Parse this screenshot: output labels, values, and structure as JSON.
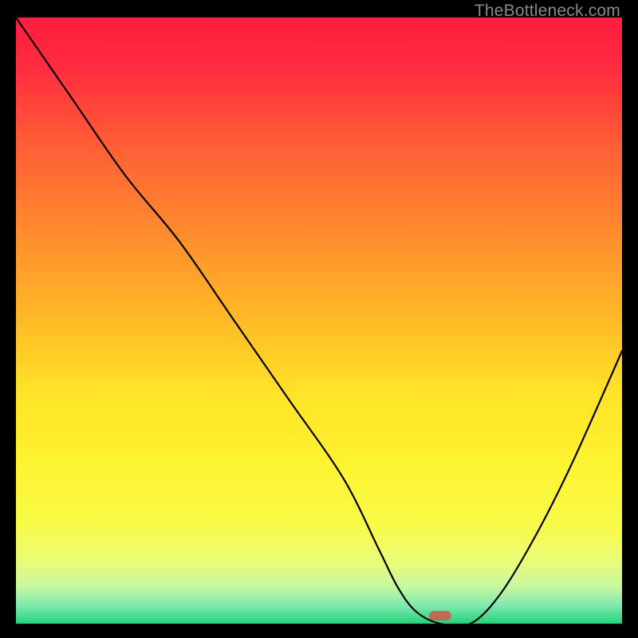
{
  "watermark": "TheBottleneck.com",
  "chart_data": {
    "type": "line",
    "title": "",
    "xlabel": "",
    "ylabel": "",
    "xlim": [
      0,
      100
    ],
    "ylim": [
      0,
      100
    ],
    "grid": false,
    "series": [
      {
        "name": "bottleneck-curve",
        "x": [
          0,
          9,
          18,
          27,
          36,
          45,
          54,
          60,
          63,
          66,
          70,
          75,
          80,
          86,
          92,
          100
        ],
        "y": [
          100,
          87,
          74,
          63,
          50,
          37,
          24,
          12,
          6,
          2,
          0,
          0,
          5,
          15,
          27,
          45
        ]
      }
    ],
    "gradient_stops": [
      {
        "pos": 0.0,
        "color": "#ff1d3f"
      },
      {
        "pos": 0.08,
        "color": "#ff2b3f"
      },
      {
        "pos": 0.2,
        "color": "#ff5a36"
      },
      {
        "pos": 0.35,
        "color": "#ff8a2e"
      },
      {
        "pos": 0.5,
        "color": "#ffbb27"
      },
      {
        "pos": 0.62,
        "color": "#ffe327"
      },
      {
        "pos": 0.74,
        "color": "#fdf431"
      },
      {
        "pos": 0.84,
        "color": "#f7fb4a"
      },
      {
        "pos": 0.9,
        "color": "#e8fc7a"
      },
      {
        "pos": 0.94,
        "color": "#c4f8a0"
      },
      {
        "pos": 0.97,
        "color": "#7fe9af"
      },
      {
        "pos": 1.0,
        "color": "#22d47a"
      }
    ],
    "marker": {
      "x_fraction": 0.7,
      "y_fraction": 0.987
    }
  }
}
